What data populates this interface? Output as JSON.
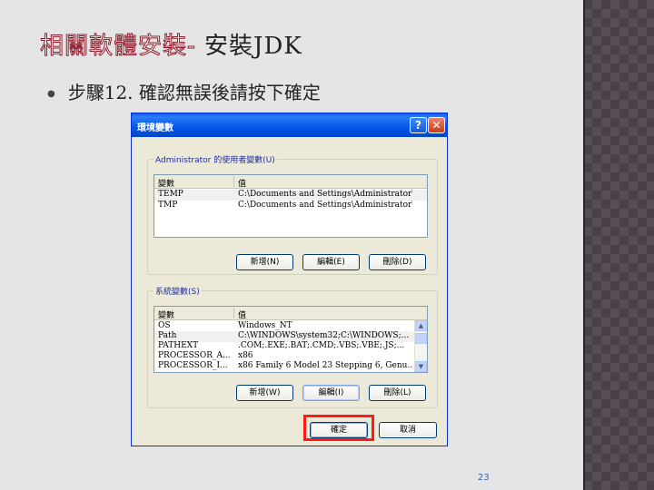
{
  "slide": {
    "title_part1": "相關軟體安裝-",
    "title_part2": " 安裝JDK",
    "bullet": "步驟12. 確認無誤後請按下確定",
    "page_number": "23"
  },
  "dialog": {
    "title": "環境變數",
    "help_symbol": "?",
    "close_symbol": "✕",
    "user_group": {
      "label": "Administrator 的使用者變數(U)",
      "columns": [
        "變數",
        "值"
      ],
      "rows": [
        {
          "name": "TEMP",
          "value": "C:\\Documents and Settings\\Administrator\\..."
        },
        {
          "name": "TMP",
          "value": "C:\\Documents and Settings\\Administrator\\..."
        }
      ],
      "buttons": {
        "new": "新增(N)",
        "edit": "編輯(E)",
        "delete": "刪除(D)"
      }
    },
    "system_group": {
      "label": "系統變數(S)",
      "columns": [
        "變數",
        "值"
      ],
      "rows": [
        {
          "name": "OS",
          "value": "Windows_NT"
        },
        {
          "name": "Path",
          "value": "C:\\WINDOWS\\system32;C:\\WINDOWS;..."
        },
        {
          "name": "PATHEXT",
          "value": ".COM;.EXE;.BAT;.CMD;.VBS;.VBE;.JS;..."
        },
        {
          "name": "PROCESSOR_A...",
          "value": "x86"
        },
        {
          "name": "PROCESSOR_I...",
          "value": "x86 Family 6 Model 23 Stepping 6, Genu..."
        }
      ],
      "buttons": {
        "new": "新增(W)",
        "edit": "編輯(I)",
        "delete": "刪除(L)"
      }
    },
    "ok_label": "確定",
    "cancel_label": "取消"
  },
  "colors": {
    "highlight": "#ff1a1a",
    "title_outline": "#8b1a2a",
    "xp_title_blue": "#0055e5"
  },
  "icons": [
    "help-icon",
    "close-icon",
    "scroll-up-icon",
    "scroll-down-icon"
  ]
}
